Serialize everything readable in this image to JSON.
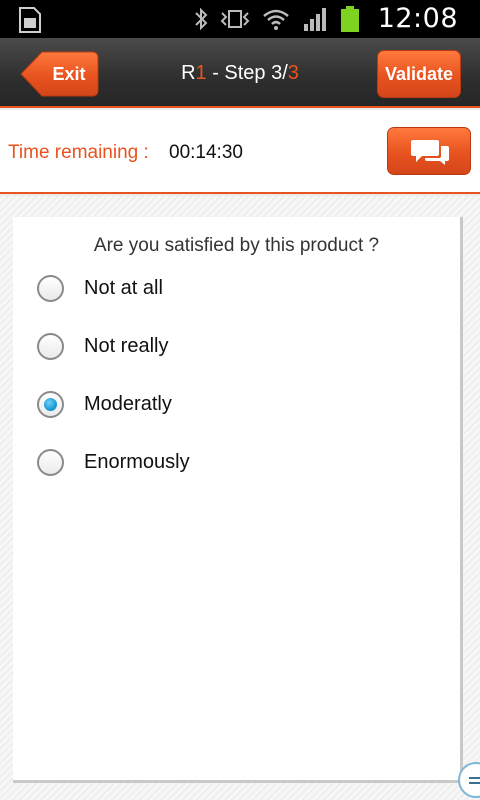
{
  "status_bar": {
    "time": "12:08",
    "icons": [
      "sim-icon",
      "bluetooth-icon",
      "vibrate-icon",
      "wifi-icon",
      "signal-icon",
      "battery-icon"
    ]
  },
  "header": {
    "exit_label": "Exit",
    "title_prefix": "R",
    "title_round": "1",
    "title_middle": " - Step 3/",
    "title_total": "3",
    "validate_label": "Validate"
  },
  "timer": {
    "label": "Time remaining : ",
    "value": "00:14:30",
    "chat_icon": "chat-bubbles-icon"
  },
  "survey": {
    "question": "Are you satisfied by this product ?",
    "options": [
      {
        "label": "Not at all",
        "checked": false
      },
      {
        "label": "Not really",
        "checked": false
      },
      {
        "label": "Moderatly",
        "checked": true
      },
      {
        "label": "Enormously",
        "checked": false
      }
    ]
  },
  "colors": {
    "accent": "#e8531f",
    "radio_selected": "#1b9ad6"
  }
}
